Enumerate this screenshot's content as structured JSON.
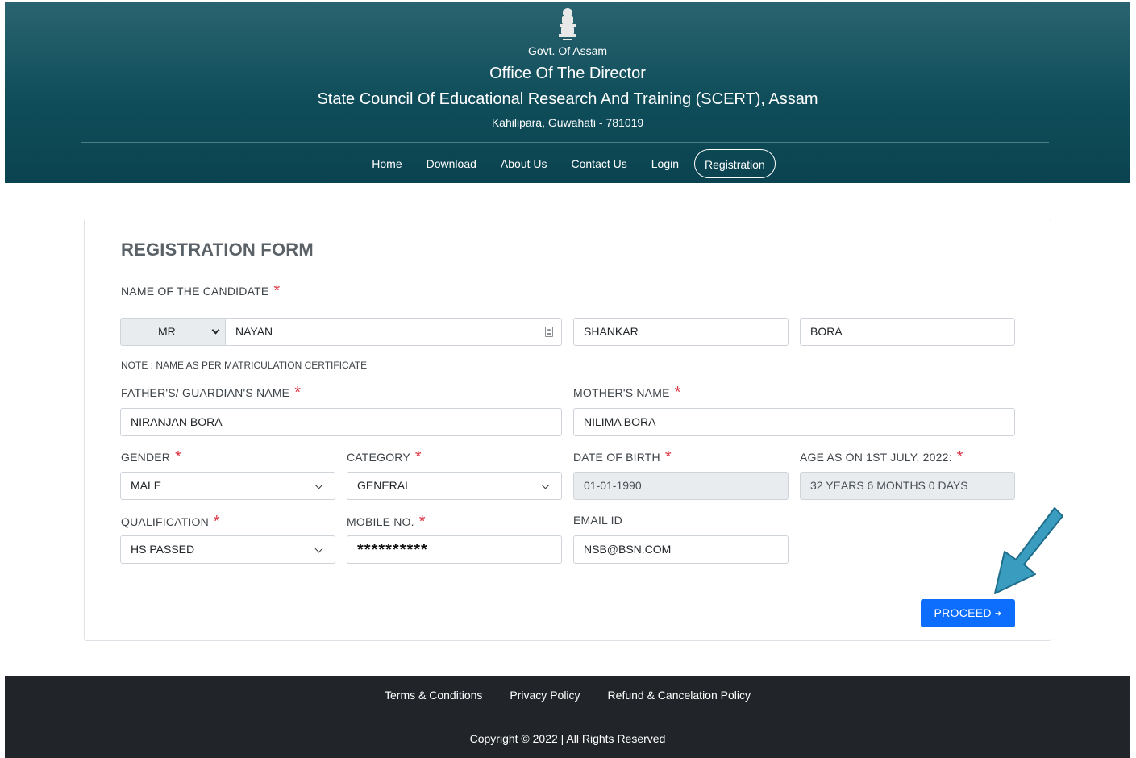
{
  "header": {
    "gov_line": "Govt. Of Assam",
    "office_line": "Office Of The Director",
    "council_line": "State Council Of Educational Research And Training (SCERT), Assam",
    "address_line": "Kahilipara, Guwahati - 781019"
  },
  "nav": {
    "items": [
      "Home",
      "Download",
      "About Us",
      "Contact Us",
      "Login",
      "Registration"
    ],
    "active": "Registration"
  },
  "form": {
    "title": "REGISTRATION FORM",
    "candidate_label": "NAME OF THE CANDIDATE",
    "salutation": "MR",
    "first_name": "NAYAN",
    "middle_name": "SHANKAR",
    "last_name": "BORA",
    "note": "NOTE : NAME AS PER MATRICULATION CERTIFICATE",
    "father_label": "FATHER'S/ GUARDIAN'S NAME",
    "father_value": "NIRANJAN BORA",
    "mother_label": "MOTHER'S NAME",
    "mother_value": "NILIMA BORA",
    "gender_label": "GENDER",
    "gender_value": "MALE",
    "category_label": "CATEGORY",
    "category_value": "GENERAL",
    "dob_label": "DATE OF BIRTH",
    "dob_value": "01-01-1990",
    "age_label": "AGE AS ON 1ST JULY, 2022:",
    "age_value": "32 YEARS 6 MONTHS 0 DAYS",
    "qualification_label": "QUALIFICATION",
    "qualification_value": "HS PASSED",
    "mobile_label": "MOBILE NO.",
    "mobile_value": "**********",
    "email_label": "EMAIL ID",
    "email_value": "NSB@BSN.COM",
    "required_mark": "*",
    "proceed_label": "PROCEED",
    "proceed_arrow": "➔"
  },
  "footer": {
    "links": [
      "Terms & Conditions",
      "Privacy Policy",
      "Refund & Cancelation Policy"
    ],
    "copyright": "Copyright © 2022 | All Rights Reserved"
  },
  "colors": {
    "header_bg": "#0f4d5a",
    "primary": "#0d6efd",
    "required": "#dc3545",
    "footer_bg": "#212529",
    "annotation_arrow": "#3a9cbf"
  }
}
